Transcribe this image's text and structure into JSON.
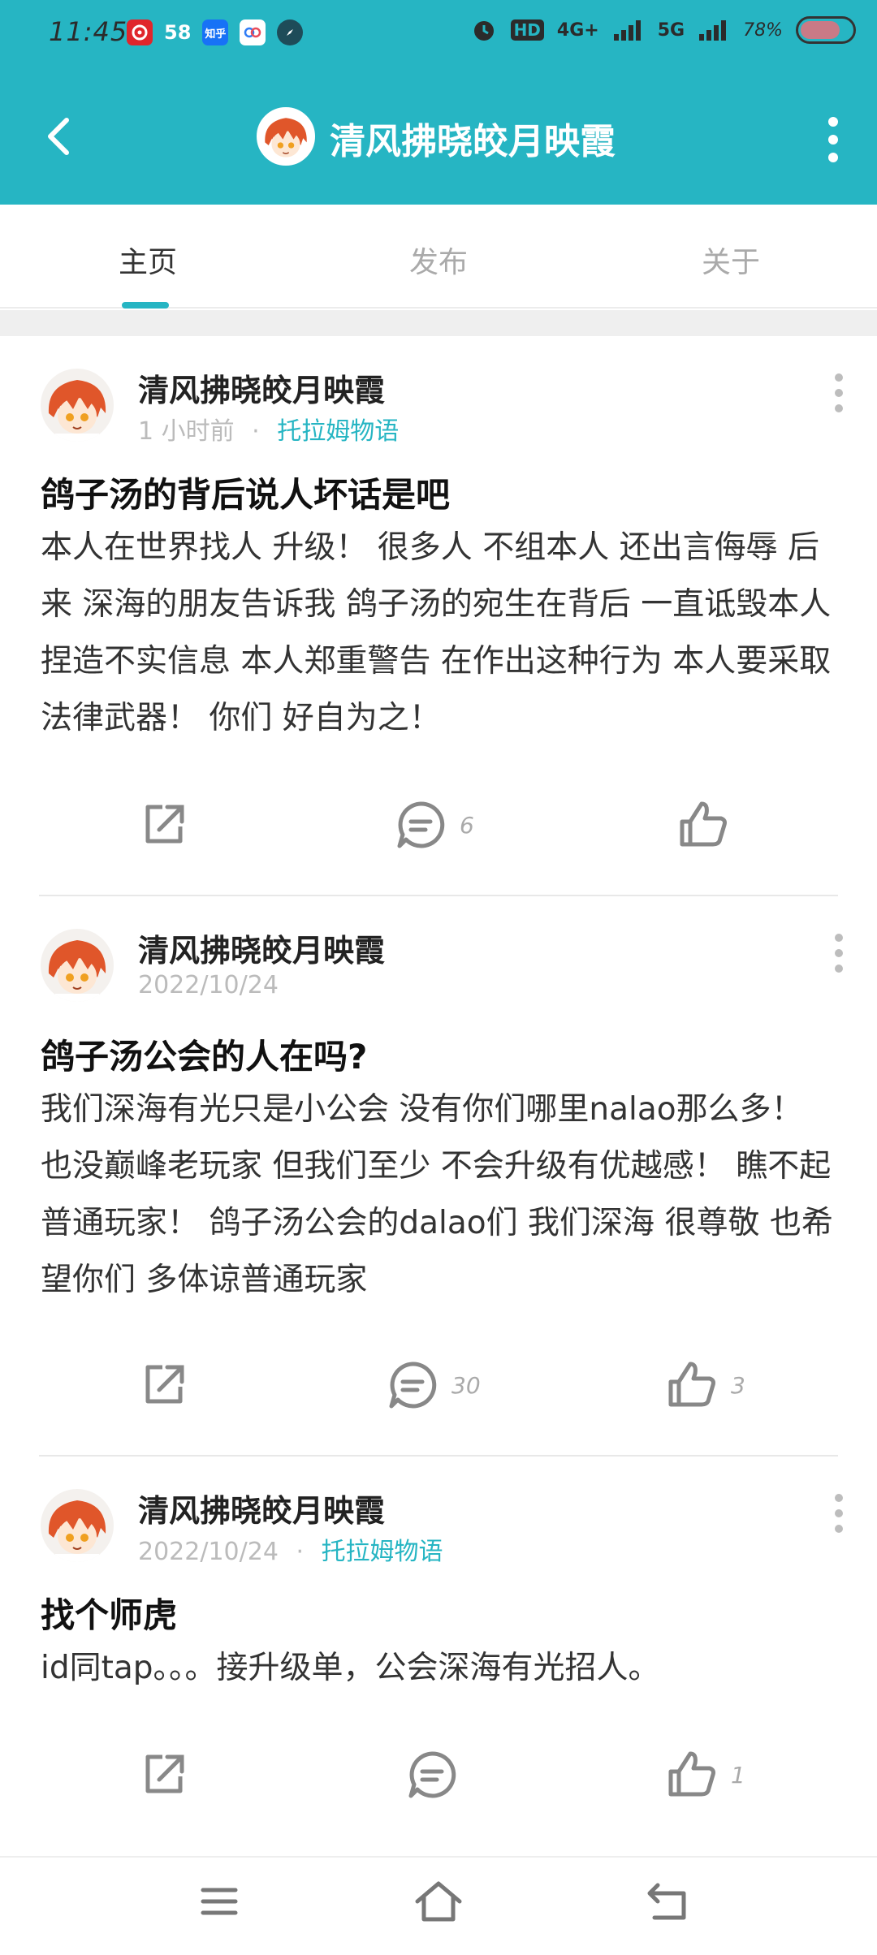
{
  "status_bar": {
    "time": "11:45",
    "app58": "58",
    "zhihu": "知乎",
    "hd": "HD",
    "net4g": "4G+",
    "net5g": "5G",
    "battery": "78%"
  },
  "header": {
    "title": "清风拂晓皎月映霞"
  },
  "tabs": [
    {
      "label": "主页",
      "active": true
    },
    {
      "label": "发布",
      "active": false
    },
    {
      "label": "关于",
      "active": false
    }
  ],
  "posts": [
    {
      "author": "清风拂晓皎月映霞",
      "time": "1 小时前",
      "sep": "·",
      "game": "托拉姆物语",
      "title": "鸽子汤的背后说人坏话是吧",
      "body": "本人在世界找人 升级！ 很多人 不组本人 还出言侮辱 后来 深海的朋友告诉我 鸽子汤的宛生在背后 一直诋毁本人 捏造不实信息 本人郑重警告 在作出这种行为 本人要采取 法律武器！ 你们 好自为之！",
      "comments": "6",
      "likes": ""
    },
    {
      "author": "清风拂晓皎月映霞",
      "time": "2022/10/24",
      "sep": "",
      "game": "",
      "title": "鸽子汤公会的人在吗?",
      "body": "我们深海有光只是小公会 没有你们哪里nalao那么多！ 也没巅峰老玩家 但我们至少 不会升级有优越感！ 瞧不起普通玩家！ 鸽子汤公会的dalao们 我们深海 很尊敬 也希望你们 多体谅普通玩家",
      "comments": "30",
      "likes": "3"
    },
    {
      "author": "清风拂晓皎月映霞",
      "time": "2022/10/24",
      "sep": "·",
      "game": "托拉姆物语",
      "title": "找个师虎",
      "body": "id同tap。。。接升级单，公会深海有光招人。",
      "comments": "",
      "likes": "1"
    }
  ],
  "colors": {
    "accent": "#26b5c3",
    "battery": "#c97a86"
  },
  "icons": [
    "back-icon",
    "more-icon",
    "share-icon",
    "comment-icon",
    "like-icon",
    "menu-icon",
    "home-icon",
    "return-icon"
  ]
}
